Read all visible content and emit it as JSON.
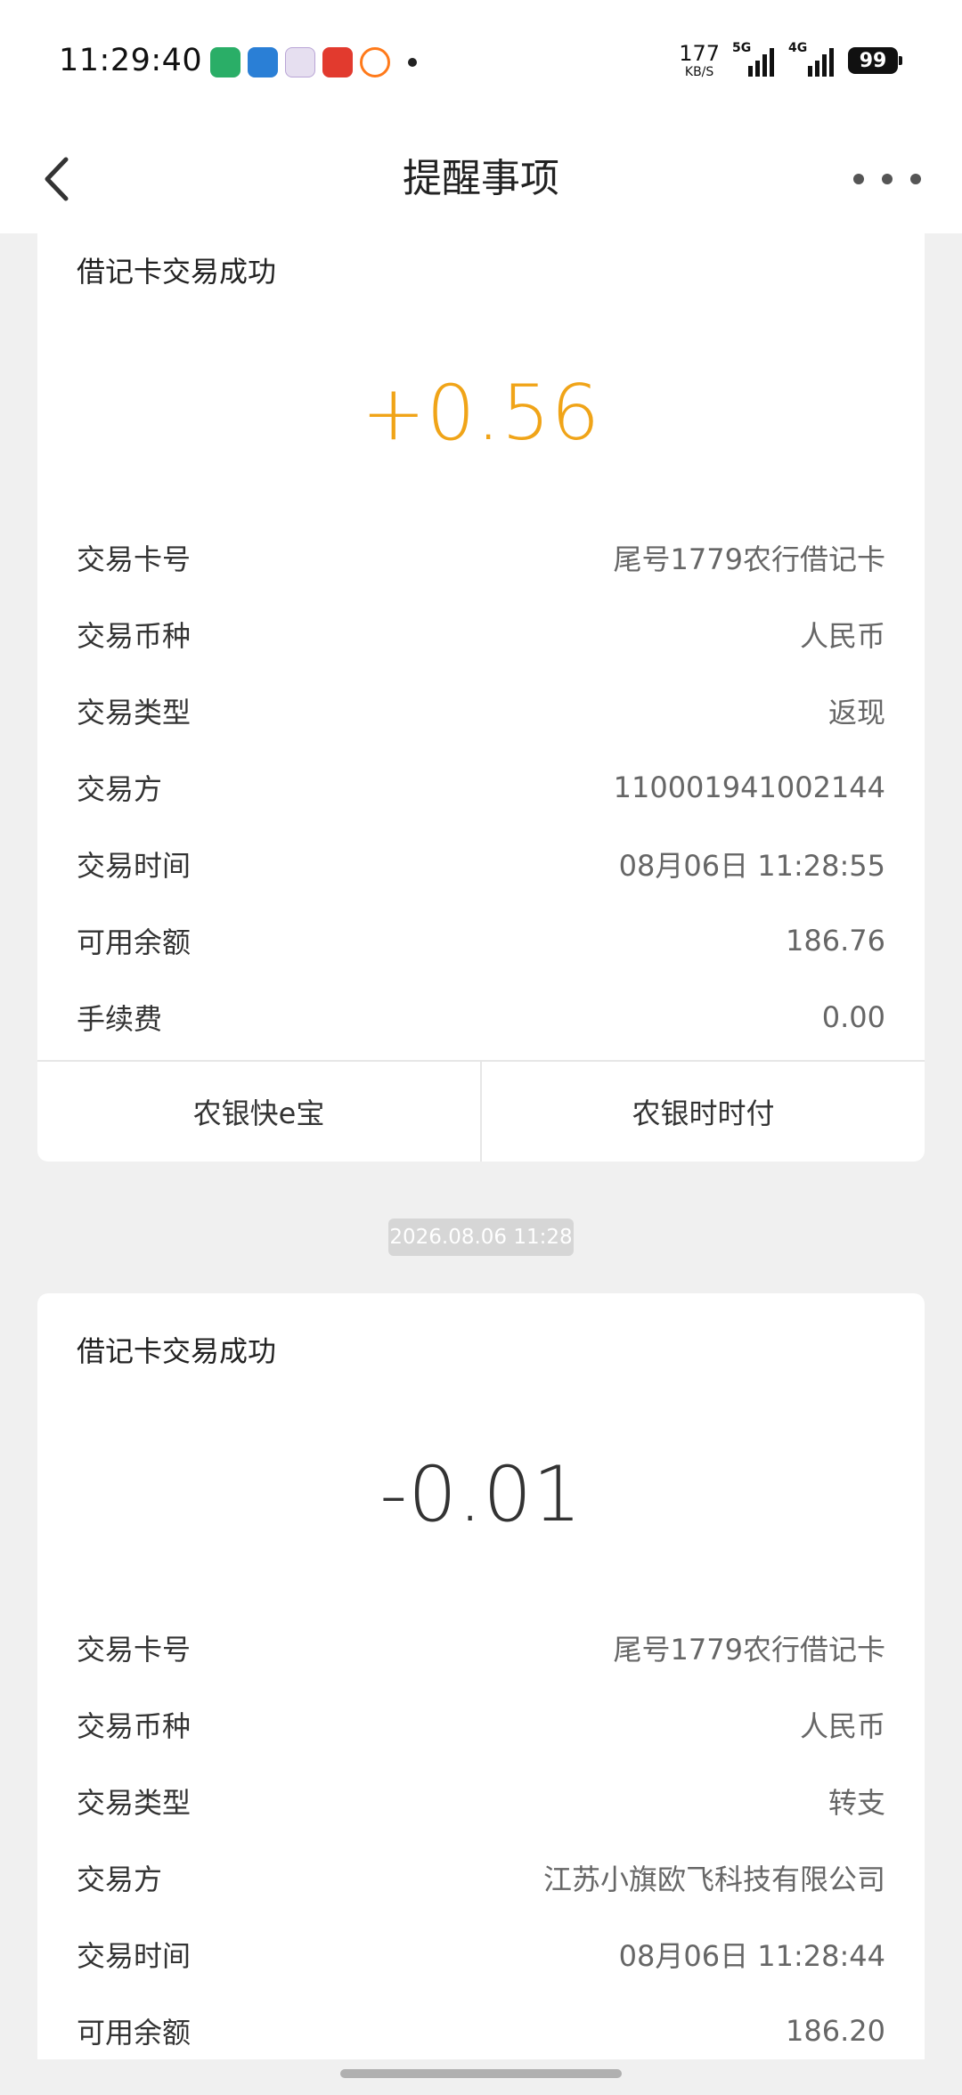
{
  "status_bar": {
    "time": "11:29:40",
    "net_speed": "177",
    "net_unit": "KB/S",
    "sig1": "5G",
    "sig2": "4G",
    "battery": "99"
  },
  "nav": {
    "title": "提醒事项"
  },
  "cards": [
    {
      "title": "借记卡交易成功",
      "amount": "+0.56",
      "rows": [
        {
          "k": "交易卡号",
          "v": "尾号1779农行借记卡"
        },
        {
          "k": "交易币种",
          "v": "人民币"
        },
        {
          "k": "交易类型",
          "v": "返现"
        },
        {
          "k": "交易方",
          "v": "110001941002144"
        },
        {
          "k": "交易时间",
          "v": "08月06日 11:28:55"
        },
        {
          "k": "可用余额",
          "v": "186.76"
        },
        {
          "k": "手续费",
          "v": "0.00"
        }
      ],
      "buttons": [
        "农银快e宝",
        "农银时时付"
      ]
    },
    {
      "title": "借记卡交易成功",
      "amount": "-0.01",
      "rows": [
        {
          "k": "交易卡号",
          "v": "尾号1779农行借记卡"
        },
        {
          "k": "交易币种",
          "v": "人民币"
        },
        {
          "k": "交易类型",
          "v": "转支"
        },
        {
          "k": "交易方",
          "v": "江苏小旗欧飞科技有限公司"
        },
        {
          "k": "交易时间",
          "v": "08月06日 11:28:44"
        },
        {
          "k": "可用余额",
          "v": "186.20"
        }
      ]
    }
  ],
  "date_badge": "2026.08.06 11:28",
  "colors": {
    "positive_amount": "#f0a418",
    "background": "#f0f0f0"
  }
}
